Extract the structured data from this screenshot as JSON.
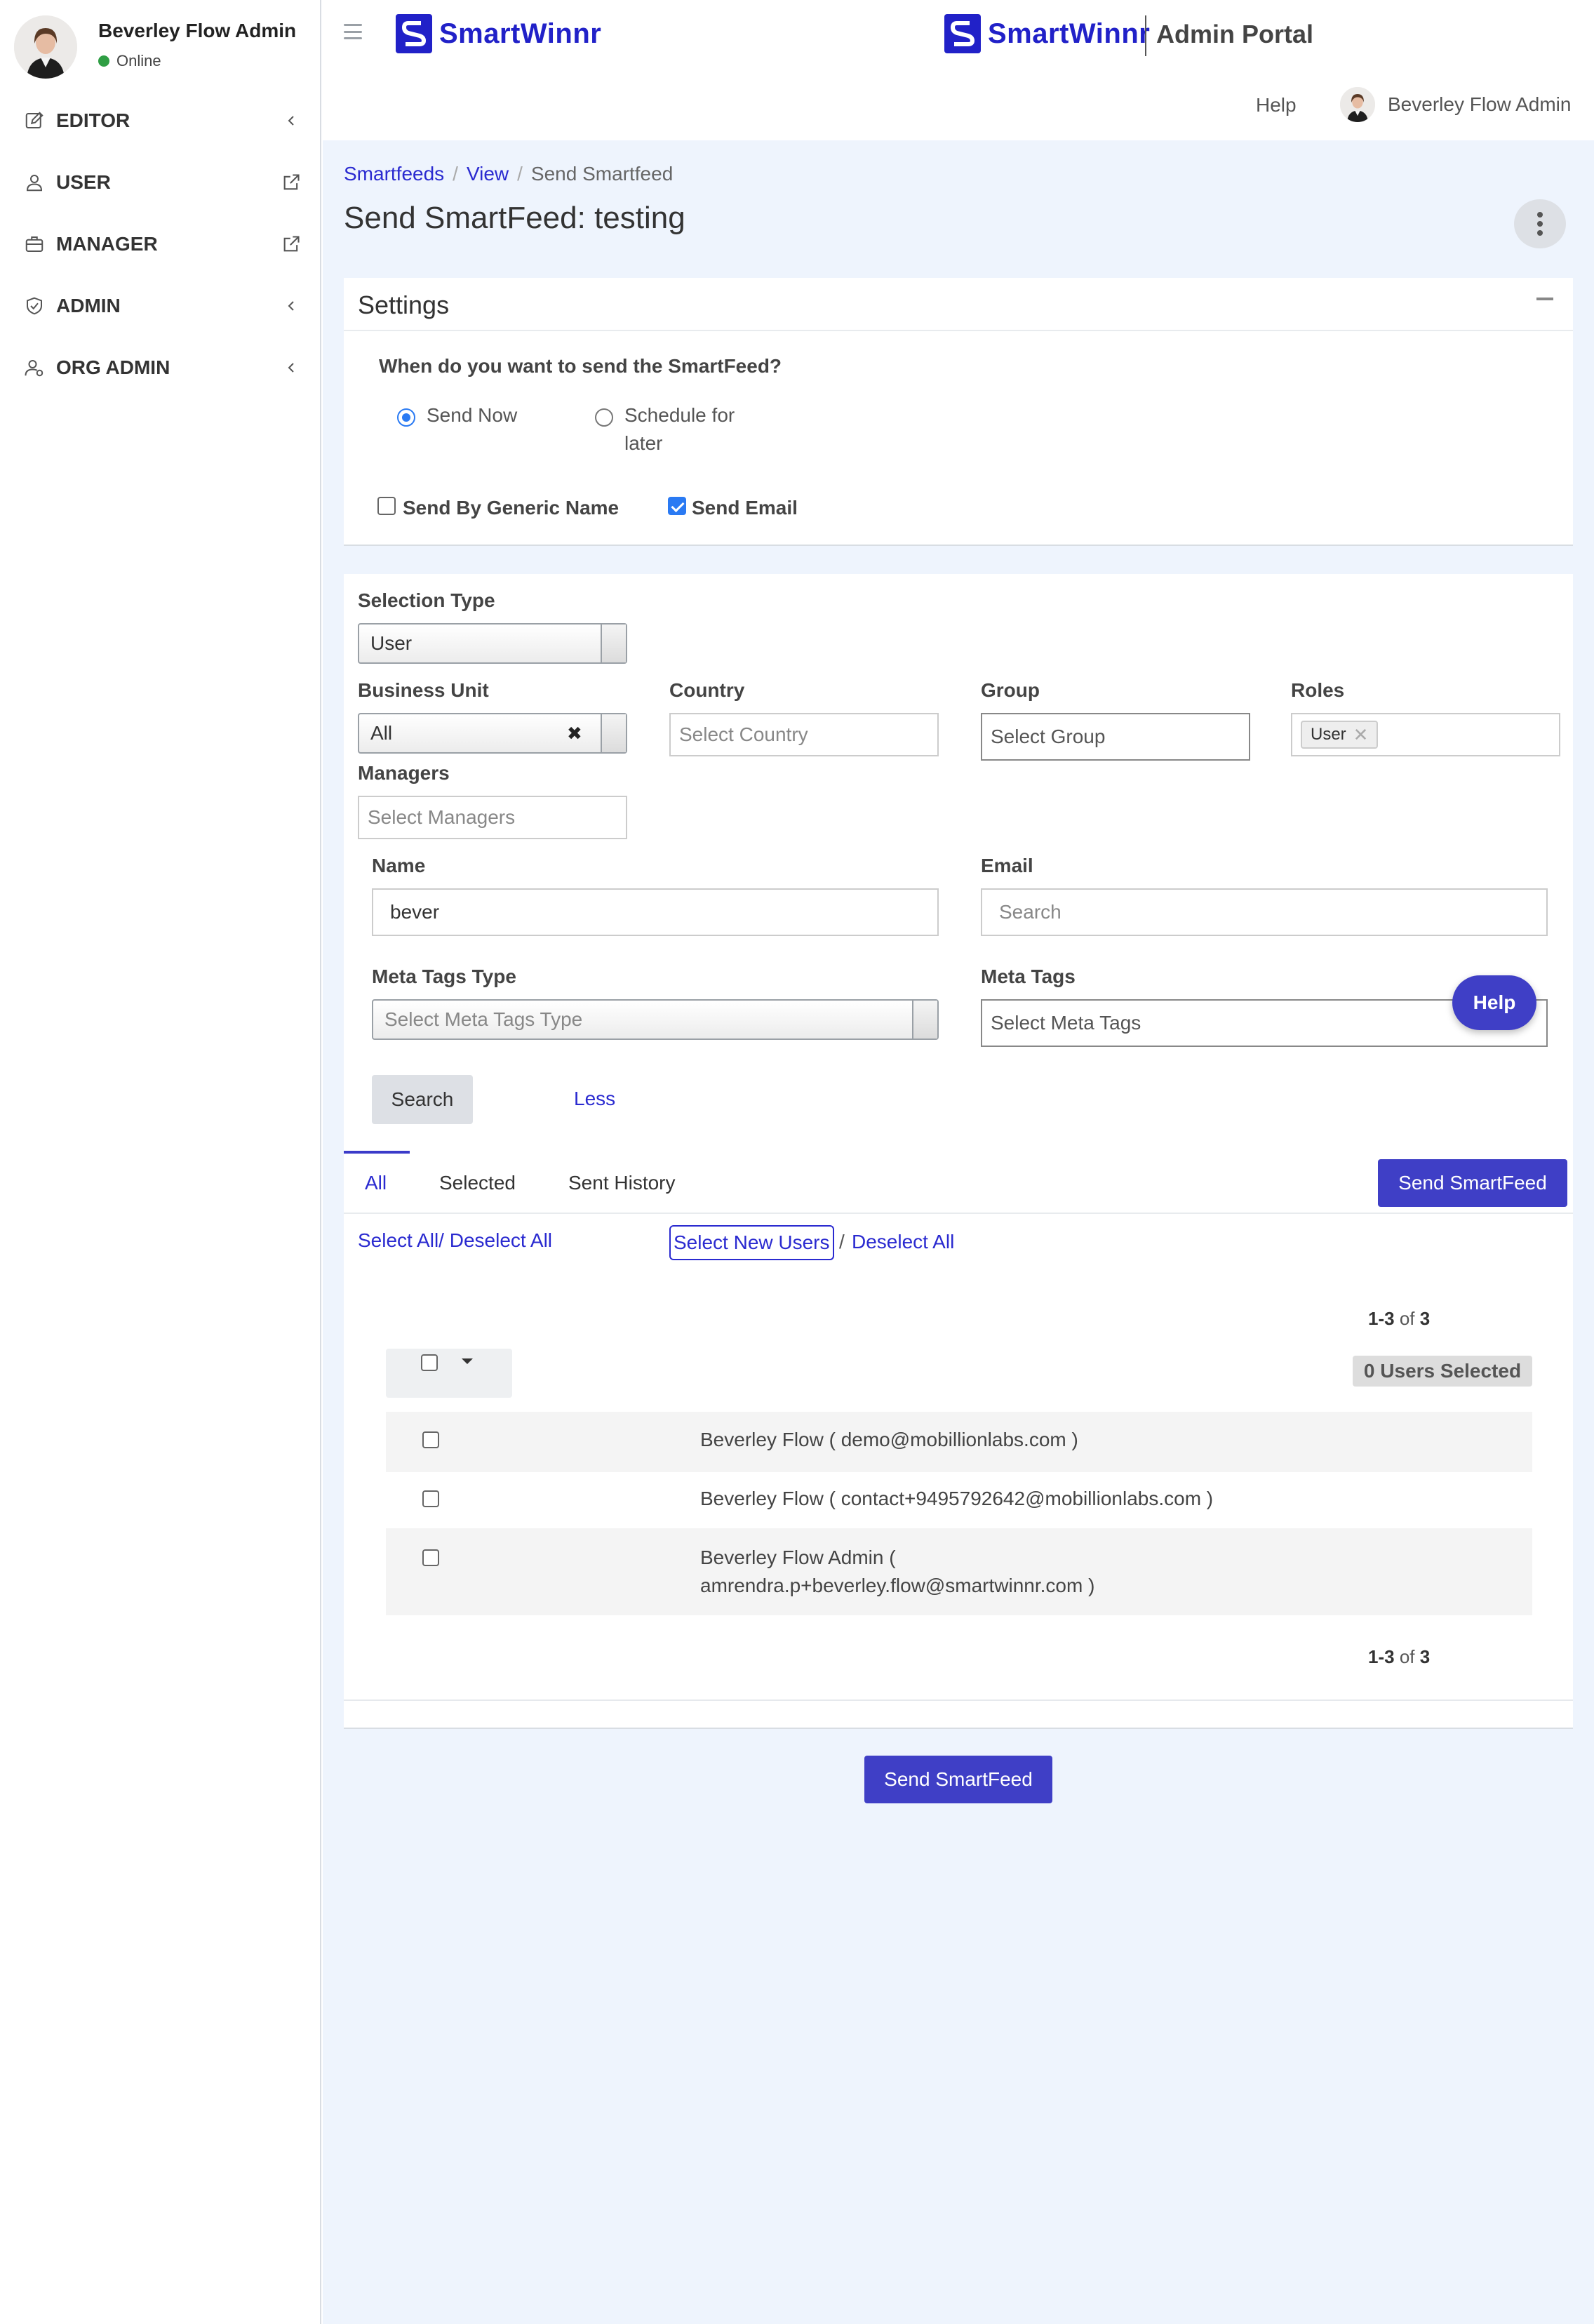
{
  "sidebar": {
    "user": {
      "name": "Beverley Flow Admin",
      "status": "Online"
    },
    "items": [
      {
        "label": "EDITOR"
      },
      {
        "label": "USER"
      },
      {
        "label": "MANAGER"
      },
      {
        "label": "ADMIN"
      },
      {
        "label": "ORG ADMIN"
      }
    ]
  },
  "header": {
    "brand": "SmartWinnr",
    "portal": "Admin Portal",
    "help": "Help",
    "user_name": "Beverley Flow Admin"
  },
  "breadcrumb": {
    "items": [
      "Smartfeeds",
      "View",
      "Send Smartfeed"
    ],
    "separator": "/"
  },
  "page_title": "Send SmartFeed: testing",
  "settings": {
    "title": "Settings",
    "question": "When do you want to send the SmartFeed?",
    "option_now": "Send Now",
    "option_later_line1": "Schedule for",
    "option_later_line2": "later",
    "selected_option": "Send Now",
    "generic_name_label": "Send By Generic Name",
    "generic_name_checked": false,
    "send_email_label": "Send Email",
    "send_email_checked": true
  },
  "filters": {
    "selection_type": {
      "label": "Selection Type",
      "value": "User"
    },
    "business_unit": {
      "label": "Business Unit",
      "value": "All",
      "clear": "✖"
    },
    "country": {
      "label": "Country",
      "placeholder": "Select Country"
    },
    "group": {
      "label": "Group",
      "placeholder": "Select Group"
    },
    "roles": {
      "label": "Roles",
      "tag": "User",
      "tag_remove": "✕"
    },
    "managers": {
      "label": "Managers",
      "placeholder": "Select Managers"
    },
    "name": {
      "label": "Name",
      "value": "bever"
    },
    "email": {
      "label": "Email",
      "placeholder": "Search"
    },
    "meta_tags_type": {
      "label": "Meta Tags Type",
      "placeholder": "Select Meta Tags Type"
    },
    "meta_tags": {
      "label": "Meta Tags",
      "placeholder": "Select Meta Tags"
    },
    "search_button": "Search",
    "less_link": "Less"
  },
  "tabs": {
    "all": "All",
    "selected": "Selected",
    "history": "Sent History"
  },
  "send_button": "Send SmartFeed",
  "selection_links": {
    "select_all": "Select All/ Deselect All",
    "select_new": "Select New Users",
    "slash": "/",
    "deselect_all": "Deselect All"
  },
  "pager": {
    "range": "1-3",
    "of": "of",
    "total": "3"
  },
  "users_selected": "0 Users Selected",
  "users": [
    {
      "line1": "Beverley Flow ( demo@mobillionlabs.com )",
      "line2": ""
    },
    {
      "line1": "Beverley Flow ( contact+9495792642@mobillionlabs.com )",
      "line2": ""
    },
    {
      "line1": "Beverley Flow Admin (",
      "line2": "amrendra.p+beverley.flow@smartwinnr.com )"
    }
  ],
  "bottom_send_button": "Send SmartFeed",
  "help_float": "Help",
  "colors": {
    "brand": "#2121c8",
    "primary_button": "#3f3fc6",
    "link": "#2a2ad0",
    "main_bg": "#eef4fd"
  }
}
